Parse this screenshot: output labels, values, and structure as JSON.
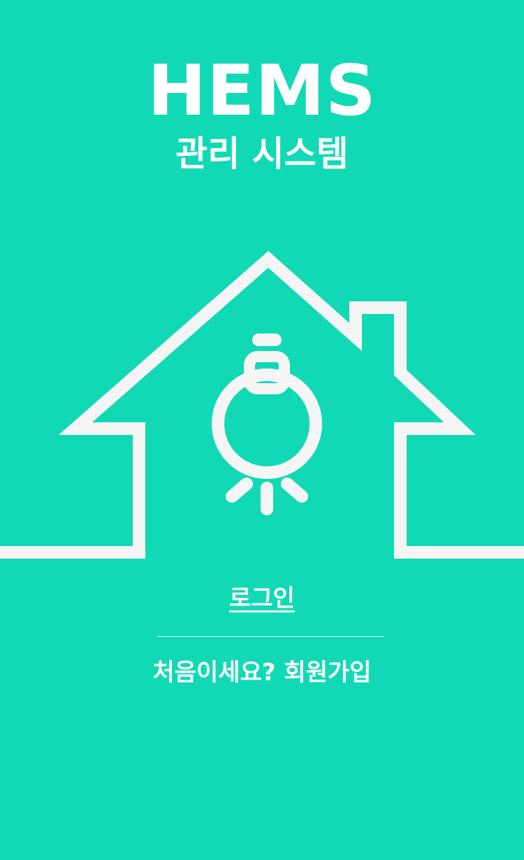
{
  "app": {
    "title": "HEMS",
    "subtitle": "관리 시스템"
  },
  "hero": {
    "icon": "house-lightbulb-icon"
  },
  "auth": {
    "login_label": "로그인",
    "signup_label": "처음이세요? 회원가입"
  },
  "colors": {
    "background": "#12d9b5",
    "foreground": "#ffffff",
    "icon": "#f5f5f5"
  }
}
